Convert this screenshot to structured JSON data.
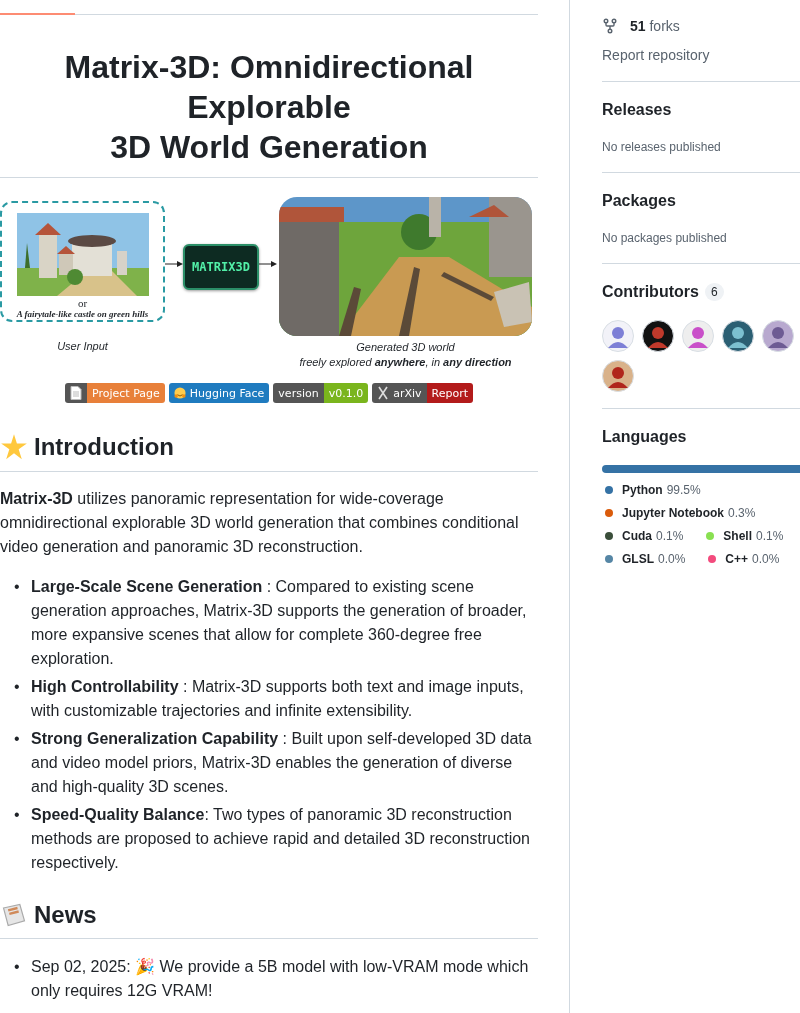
{
  "readme": {
    "title_lines": [
      "Matrix-3D: Omnidirectional Explorable",
      "3D World Generation"
    ],
    "figure": {
      "input_picture": {
        "kind": "picture"
      },
      "or_text": "or",
      "prompt": "A fairytale-like castle on green hills",
      "input_label": "User Input",
      "model_label": "MATRIX3D",
      "output_picture": {
        "kind": "picture"
      },
      "output_caption": [
        "Generated 3D world",
        "freely explored **anywhere**, in **any direction**"
      ]
    },
    "badges": [
      {
        "kind": "document",
        "message": "Project Page",
        "color": "#e8803a"
      },
      {
        "kind": "hug",
        "message": "Hugging Face",
        "color": "#1f7bbf"
      },
      {
        "kind": "plain",
        "label": "version",
        "message": "v0.1.0",
        "color": "#7ab51d"
      },
      {
        "kind": "cross",
        "label": "arXiv",
        "message": "Report",
        "color": "#b31b1b"
      }
    ],
    "intro": {
      "heading": "Introduction",
      "paragraph": "**Matrix-3D** utilizes panoramic representation for wide-coverage omnidirectional explorable 3D world generation that combines conditional video generation and panoramic 3D reconstruction.",
      "bullets": [
        {
          "marker": "•",
          "text": "**Large-Scale Scene Generation** : Compared to existing scene generation approaches, Matrix-3D supports the generation of broader, more expansive scenes that allow for complete 360-degree free exploration."
        },
        {
          "marker": "•",
          "text": "**High Controllability** : Matrix-3D supports both text and image inputs, with customizable trajectories and infinite extensibility."
        },
        {
          "marker": "•",
          "text": "**Strong Generalization Capability** : Built upon self-developed 3D data and video model priors, Matrix-3D enables the generation of diverse and high-quality 3D scenes."
        },
        {
          "marker": "•",
          "text": "**Speed-Quality Balance**: Two types of panoramic 3D reconstruction methods are proposed to achieve rapid and detailed 3D reconstruction respectively."
        }
      ]
    },
    "news": {
      "heading": "News",
      "items": [
        {
          "marker": "•",
          "text": "Sep 02, 2025: 🎉 We provide a 5B model with low-VRAM mode which only requires 12G VRAM!"
        }
      ]
    }
  },
  "sidebar": {
    "forks": {
      "count": "51",
      "label": "forks"
    },
    "report": "Report repository",
    "releases": {
      "heading": "Releases",
      "empty": "No releases published"
    },
    "packages": {
      "heading": "Packages",
      "empty": "No packages published"
    },
    "contributors": {
      "heading": "Contributors",
      "count": "6",
      "avatars": [
        {
          "kind": "picture"
        },
        {
          "kind": "picture"
        },
        {
          "kind": "picture"
        },
        {
          "kind": "picture"
        },
        {
          "kind": "picture"
        },
        {
          "kind": "picture"
        }
      ]
    },
    "languages": {
      "heading": "Languages",
      "items": [
        {
          "name": "Python",
          "percent": "99.5%",
          "color": "#3572a5"
        },
        {
          "name": "Jupyter Notebook",
          "percent": "0.3%",
          "color": "#da5b0b"
        },
        {
          "name": "Cuda",
          "percent": "0.1%",
          "color": "#3a4e3a"
        },
        {
          "name": "Shell",
          "percent": "0.1%",
          "color": "#89e051"
        },
        {
          "name": "GLSL",
          "percent": "0.0%",
          "color": "#5686a5"
        },
        {
          "name": "C++",
          "percent": "0.0%",
          "color": "#f34b7d"
        }
      ]
    }
  }
}
